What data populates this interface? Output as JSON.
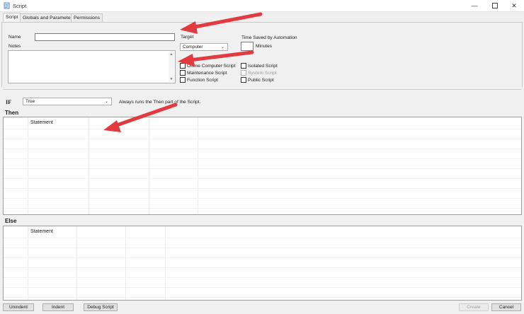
{
  "window": {
    "title": "Script"
  },
  "tabs": [
    {
      "label": "Script",
      "active": true
    },
    {
      "label": "Globals and Parameters",
      "active": false
    },
    {
      "label": "Permissions",
      "active": false
    }
  ],
  "form": {
    "name_label": "Name",
    "name_value": "",
    "notes_label": "Notes",
    "notes_value": "",
    "target_label": "Target",
    "target_value": "Computer",
    "time_saved_label": "Time Saved by Automation",
    "time_saved_value": "",
    "minutes_label": "Minutes",
    "checkboxes_left": [
      {
        "label": "Offline Computer Script",
        "checked": false,
        "enabled": true
      },
      {
        "label": "Maintenance Script",
        "checked": false,
        "enabled": true
      },
      {
        "label": "Function Script",
        "checked": false,
        "enabled": true
      }
    ],
    "checkboxes_right": [
      {
        "label": "Isolated Script",
        "checked": false,
        "enabled": true
      },
      {
        "label": "System Script",
        "checked": false,
        "enabled": false
      },
      {
        "label": "Public Script",
        "checked": false,
        "enabled": true
      }
    ]
  },
  "if_section": {
    "label": "IF",
    "condition_value": "True",
    "description": "Always runs the Then part of the Script."
  },
  "then_section": {
    "label": "Then",
    "column_header": "Statement"
  },
  "else_section": {
    "label": "Else",
    "column_header": "Statement"
  },
  "buttons": {
    "unindent": "Unindent",
    "indent": "Indent",
    "debug": "Debug Script",
    "create": "Create",
    "cancel": "Cancel"
  },
  "colors": {
    "annotation_arrow": "#e23a3f",
    "window_background": "#f0f0f0"
  }
}
